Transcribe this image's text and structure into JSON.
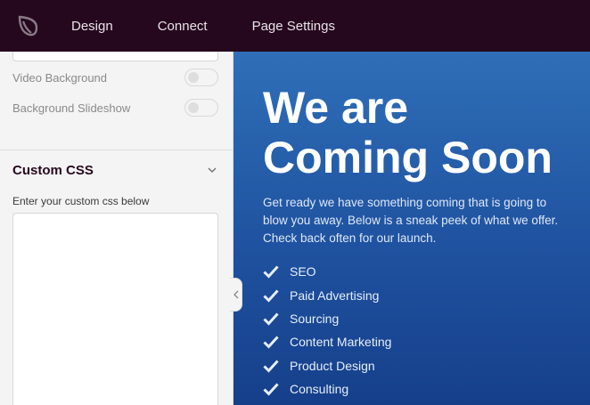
{
  "topbar": {
    "logo_icon": "seedprod-leaf-icon",
    "nav": [
      "Design",
      "Connect",
      "Page Settings"
    ]
  },
  "sidebar": {
    "video_background_label": "Video Background",
    "background_slideshow_label": "Background Slideshow",
    "custom_css_title": "Custom CSS",
    "custom_css_hint": "Enter your custom css below",
    "custom_css_value": ""
  },
  "preview": {
    "headline_line1": "We are",
    "headline_line2": "Coming Soon",
    "subtext": "Get ready we have something coming that is going to blow you away. Below is a sneak peek of what we offer. Check back often for our launch.",
    "features": [
      "SEO",
      "Paid Advertising",
      "Sourcing",
      "Content Marketing",
      "Product Design",
      "Consulting"
    ]
  },
  "colors": {
    "topbar_bg": "#25081e",
    "preview_gradient_top": "#2f6fb8",
    "preview_gradient_bottom": "#163f8a"
  }
}
